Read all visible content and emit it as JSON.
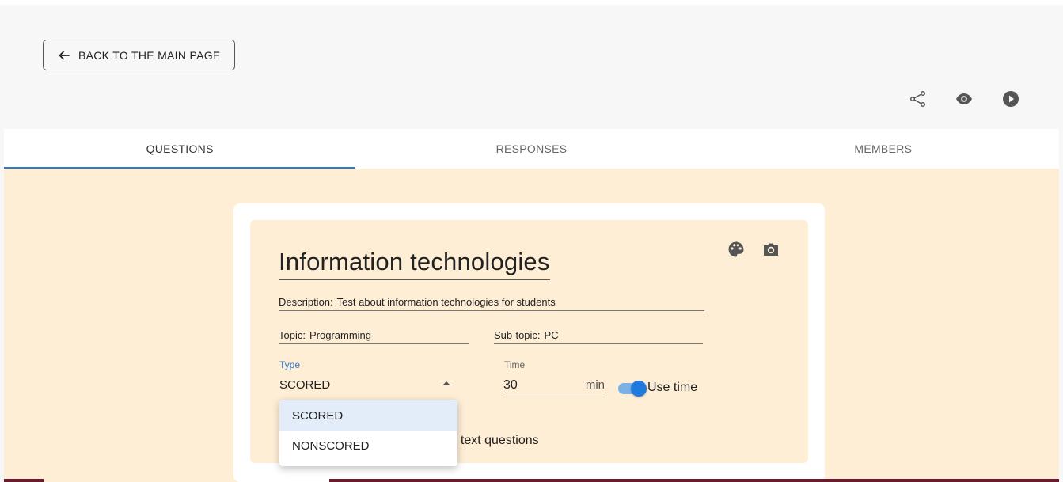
{
  "back_button": {
    "label": "BACK TO THE MAIN PAGE",
    "icon": "arrow-left-icon"
  },
  "toolbar": {
    "icons": [
      "share-icon",
      "eye-icon",
      "play-icon"
    ]
  },
  "tabs": [
    {
      "label": "QUESTIONS",
      "active": true
    },
    {
      "label": "RESPONSES",
      "active": false
    },
    {
      "label": "MEMBERS",
      "active": false
    }
  ],
  "quiz": {
    "title": "Information technologies",
    "description_label": "Description:",
    "description_value": "Test about information technologies for students",
    "topic_label": "Topic:",
    "topic_value": "Programming",
    "subtopic_label": "Sub-topic:",
    "subtopic_value": "PC",
    "type_label": "Type",
    "type_value": "SCORED",
    "time_label": "Time",
    "time_value": "30",
    "time_unit": "min",
    "use_time_label": "Use time",
    "use_time_on": true,
    "partial_text": "f text questions"
  },
  "type_menu": {
    "options": [
      "SCORED",
      "NONSCORED"
    ],
    "selected": "SCORED"
  },
  "colors": {
    "accent": "#2a7ad1",
    "card_bg": "#ffeed6",
    "toggle": "#1f7ae0"
  }
}
